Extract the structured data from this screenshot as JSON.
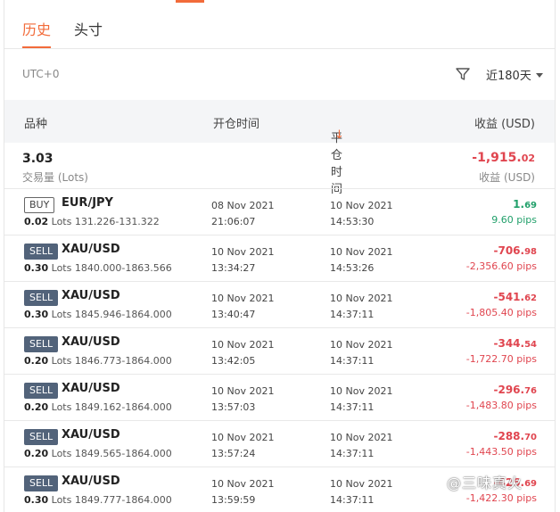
{
  "tabs": [
    {
      "label": "历史",
      "active": true
    },
    {
      "label": "头寸",
      "active": false
    }
  ],
  "toolbar": {
    "timezone": "UTC+0",
    "filter_icon": "filter-icon",
    "range_label": "近180天"
  },
  "table_header": {
    "instrument": "品种",
    "open_time": "开仓时间",
    "close_time": "平仓时间",
    "sort_arrow": "↓",
    "profit": "收益 (USD)"
  },
  "summary": {
    "volume": "3.03",
    "volume_label": "交易量 (Lots)",
    "pnl_main": "-1,915.",
    "pnl_small": "02",
    "pnl_label": "收益 (USD)"
  },
  "trades": [
    {
      "side": "BUY",
      "symbol": "EUR/JPY",
      "lots": "0.02",
      "lots_unit": "Lots",
      "price_range": "131.226-131.322",
      "open_date": "08 Nov 2021",
      "open_time": "21:06:07",
      "close_date": "10 Nov 2021",
      "close_time": "14:53:30",
      "pnl_main": "1.",
      "pnl_small": "69",
      "pips": "9.60 pips",
      "positive": true
    },
    {
      "side": "SELL",
      "symbol": "XAU/USD",
      "lots": "0.30",
      "lots_unit": "Lots",
      "price_range": "1840.000-1863.566",
      "open_date": "10 Nov 2021",
      "open_time": "13:34:27",
      "close_date": "10 Nov 2021",
      "close_time": "14:53:26",
      "pnl_main": "-706.",
      "pnl_small": "98",
      "pips": "-2,356.60 pips",
      "positive": false
    },
    {
      "side": "SELL",
      "symbol": "XAU/USD",
      "lots": "0.30",
      "lots_unit": "Lots",
      "price_range": "1845.946-1864.000",
      "open_date": "10 Nov 2021",
      "open_time": "13:40:47",
      "close_date": "10 Nov 2021",
      "close_time": "14:37:11",
      "pnl_main": "-541.",
      "pnl_small": "62",
      "pips": "-1,805.40 pips",
      "positive": false
    },
    {
      "side": "SELL",
      "symbol": "XAU/USD",
      "lots": "0.20",
      "lots_unit": "Lots",
      "price_range": "1846.773-1864.000",
      "open_date": "10 Nov 2021",
      "open_time": "13:42:05",
      "close_date": "10 Nov 2021",
      "close_time": "14:37:11",
      "pnl_main": "-344.",
      "pnl_small": "54",
      "pips": "-1,722.70 pips",
      "positive": false
    },
    {
      "side": "SELL",
      "symbol": "XAU/USD",
      "lots": "0.20",
      "lots_unit": "Lots",
      "price_range": "1849.162-1864.000",
      "open_date": "10 Nov 2021",
      "open_time": "13:57:03",
      "close_date": "10 Nov 2021",
      "close_time": "14:37:11",
      "pnl_main": "-296.",
      "pnl_small": "76",
      "pips": "-1,483.80 pips",
      "positive": false
    },
    {
      "side": "SELL",
      "symbol": "XAU/USD",
      "lots": "0.20",
      "lots_unit": "Lots",
      "price_range": "1849.565-1864.000",
      "open_date": "10 Nov 2021",
      "open_time": "13:57:24",
      "close_date": "10 Nov 2021",
      "close_time": "14:37:11",
      "pnl_main": "-288.",
      "pnl_small": "70",
      "pips": "-1,443.50 pips",
      "positive": false
    },
    {
      "side": "SELL",
      "symbol": "XAU/USD",
      "lots": "0.30",
      "lots_unit": "Lots",
      "price_range": "1849.777-1864.000",
      "open_date": "10 Nov 2021",
      "open_time": "13:59:59",
      "close_date": "10 Nov 2021",
      "close_time": "14:37:11",
      "pnl_main": "-426.",
      "pnl_small": "69",
      "pips": "-1,422.30 pips",
      "positive": false
    }
  ],
  "watermark": "@三味真火",
  "colors": {
    "accent": "#f26b3a",
    "negative": "#e0454f",
    "positive": "#22a06b",
    "sell_badge": "#52637a"
  }
}
